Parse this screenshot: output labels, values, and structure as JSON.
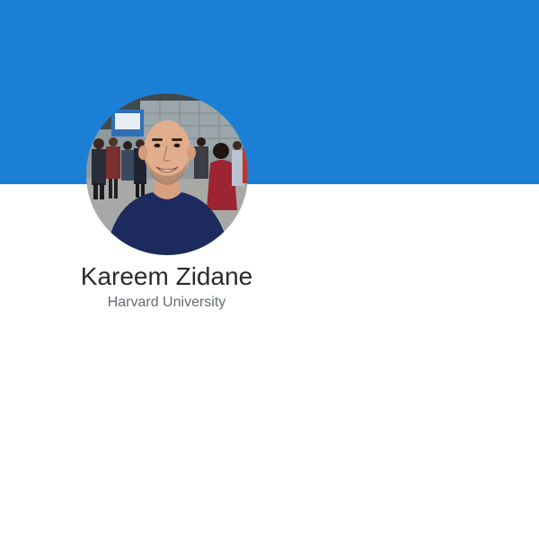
{
  "profile": {
    "name": "Kareem Zidane",
    "affiliation": "Harvard University"
  },
  "colors": {
    "banner": "#1b7fd6",
    "name_text": "#2b2b2b",
    "affiliation_text": "#666b70",
    "background": "#ffffff"
  },
  "icons": {
    "avatar": "profile-photo"
  }
}
